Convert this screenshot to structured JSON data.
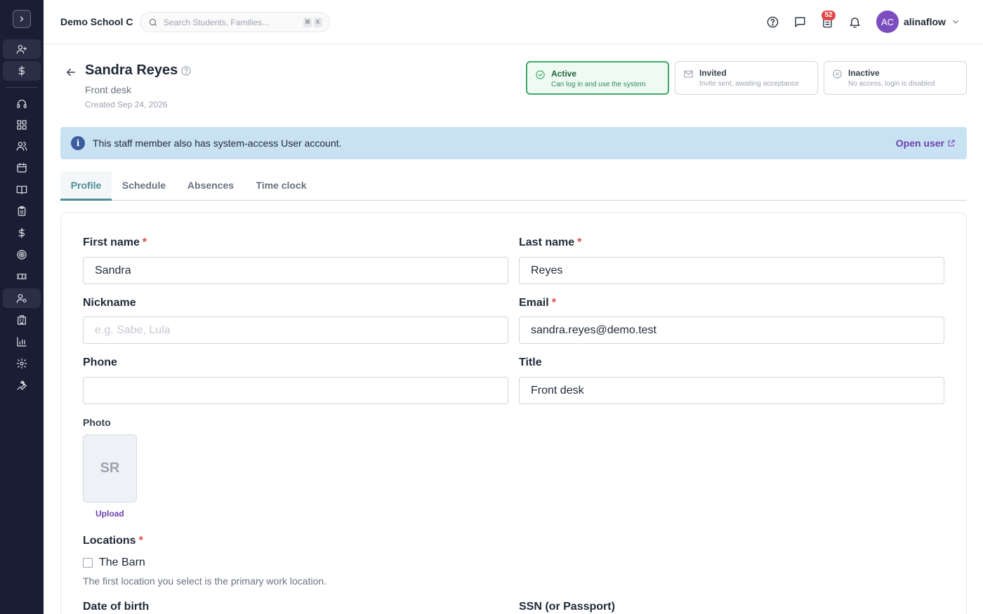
{
  "header": {
    "school_name": "Demo School C",
    "search_placeholder": "Search Students, Families...",
    "shortcut_keys": [
      "⌘",
      "K"
    ],
    "notification_count": "52",
    "user_initials": "AC",
    "user_name": "alinaflow"
  },
  "sidebar": {
    "items": [
      "add-user",
      "dollar",
      "headset",
      "dashboard",
      "users",
      "calendar",
      "book",
      "clipboard",
      "dollar",
      "target",
      "ticket",
      "staff",
      "building",
      "chart",
      "settings",
      "wrench"
    ],
    "active": "staff"
  },
  "staff": {
    "name": "Sandra Reyes",
    "role": "Front desk",
    "created": "Created Sep 24, 2026"
  },
  "statuses": [
    {
      "title": "Active",
      "desc": "Can log in and use the system",
      "selected": true
    },
    {
      "title": "Invited",
      "desc": "Invite sent, awaiting acceptance",
      "selected": false
    },
    {
      "title": "Inactive",
      "desc": "No access, login is disabled",
      "selected": false
    }
  ],
  "banner": {
    "text": "This staff member also has system-access User account.",
    "link": "Open user"
  },
  "tabs": [
    {
      "label": "Profile",
      "active": true
    },
    {
      "label": "Schedule",
      "active": false
    },
    {
      "label": "Absences",
      "active": false
    },
    {
      "label": "Time clock",
      "active": false
    }
  ],
  "form": {
    "first_name": {
      "label": "First name",
      "value": "Sandra",
      "required": true
    },
    "last_name": {
      "label": "Last name",
      "value": "Reyes",
      "required": true
    },
    "nickname": {
      "label": "Nickname",
      "value": "",
      "placeholder": "e.g. Sabe, Lula"
    },
    "email": {
      "label": "Email",
      "value": "sandra.reyes@demo.test",
      "required": true
    },
    "phone": {
      "label": "Phone",
      "value": ""
    },
    "title": {
      "label": "Title",
      "value": "Front desk"
    },
    "photo": {
      "label": "Photo",
      "initials": "SR",
      "upload": "Upload"
    },
    "locations": {
      "label": "Locations",
      "required": true,
      "option": "The Barn",
      "checked": false,
      "hint": "The first location you select is the primary work location."
    },
    "dob": {
      "label": "Date of birth"
    },
    "ssn": {
      "label": "SSN (or Passport)"
    }
  },
  "colors": {
    "sidebar_bg": "#1a1d33",
    "accent_teal": "#4e8c96",
    "link_purple": "#6b3fb0",
    "active_green": "#3fa86b",
    "banner_bg": "#c9e2f3",
    "required_red": "#e04848"
  }
}
